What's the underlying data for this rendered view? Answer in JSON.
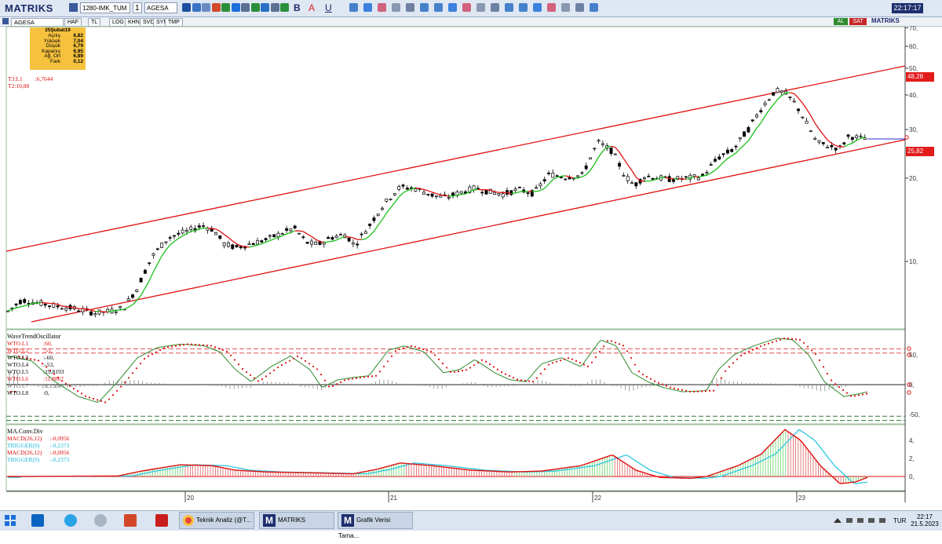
{
  "app": {
    "logo": "MATRIKS",
    "clock": "22:17:17"
  },
  "toolbar": {
    "layout_combo": "1280-IMK_TUM",
    "number_combo": "1",
    "symbol_combo": "AGESA",
    "font_b": "B",
    "font_a": "A",
    "font_u": "U"
  },
  "row2": {
    "symbol": "AGESA",
    "tabs": [
      "HAF",
      "TL",
      "LOG",
      "KHN",
      "SVD",
      "SYM",
      "TMP"
    ],
    "al_label": "AL",
    "sat_label": "SAT",
    "watermark": "MATRIKS"
  },
  "infobox": {
    "date": "25Şubat19",
    "rows": [
      {
        "label": "Açılış",
        "value": "6,82"
      },
      {
        "label": "Yüksek",
        "value": "7,04"
      },
      {
        "label": "Düşük",
        "value": "6,79"
      },
      {
        "label": "Kapanış",
        "value": "6,95"
      },
      {
        "label": "Ağ. Ort",
        "value": "6,89"
      },
      {
        "label": "Fark",
        "value": "0,12"
      }
    ]
  },
  "price_panel": {
    "labels": [
      {
        "name": "T3:L1",
        "value": ":6,7644",
        "color": "#d11"
      },
      {
        "name": "T2:10,88",
        "value": "",
        "color": "#d11"
      }
    ],
    "y_ticks": [
      "70,",
      "60,",
      "50,",
      "40,",
      "30,",
      "20,",
      "10,"
    ],
    "upper_badge": "48,28",
    "lower_badge": "25,82",
    "colors": {
      "up_candle": "#ffffff",
      "down_candle": "#000000",
      "channel": "#e01010",
      "ma_up": "#18c018",
      "ma_down": "#e01010",
      "badge": "#e21b1b"
    }
  },
  "wto_panel": {
    "title": "WaveTrendOscillator",
    "rows": [
      {
        "name": "WTO.L1",
        "value": ":60,",
        "color": "#d11"
      },
      {
        "name": "WTO.L2",
        "value": ":53,",
        "color": "#d11"
      },
      {
        "name": "WTO.L3",
        "value": ":-60,",
        "color": "#000"
      },
      {
        "name": "WTO.L4",
        "value": ":-53,",
        "color": "#000"
      },
      {
        "name": "WTO.L5",
        "value": ":19,8193",
        "color": "#000"
      },
      {
        "name": "WTO.L6",
        "value": ":11,8867",
        "color": "#d11"
      },
      {
        "name": "WTO.L7",
        "value": ":8,1326",
        "color": "#777"
      },
      {
        "name": "WTO.L8",
        "value": ":0,",
        "color": "#000"
      }
    ],
    "y_ticks": [
      "50,",
      "0,",
      "-50,"
    ]
  },
  "macd_panel": {
    "title": "MA.Conv.Div",
    "rows": [
      {
        "name": "MACD(26,12)",
        "value": ":-0,0956",
        "color": "#d11"
      },
      {
        "name": "TRIGGER(9)",
        "value": ":-0,2373",
        "color": "#19b5d8"
      },
      {
        "name": "MACD(26,12)",
        "value": ":-0,0956",
        "color": "#d11"
      },
      {
        "name": "TRIGGER(9)",
        "value": ":-0,2373",
        "color": "#19b5d8"
      }
    ],
    "y_ticks": [
      "4,",
      "2,",
      "0,"
    ]
  },
  "x_axis": {
    "labels": [
      "20",
      "21",
      "22",
      "23"
    ]
  },
  "taskbar": {
    "items": [
      {
        "label": "Teknik Analiz (@T...",
        "icon": "chrome-icon"
      },
      {
        "label": "MATRIKS",
        "icon": "matriks-icon"
      },
      {
        "label": "Grafik Verisi Tama...",
        "icon": "matriks-icon"
      }
    ],
    "language": "TUR",
    "time": "22:17",
    "date": "21.5.2023"
  }
}
